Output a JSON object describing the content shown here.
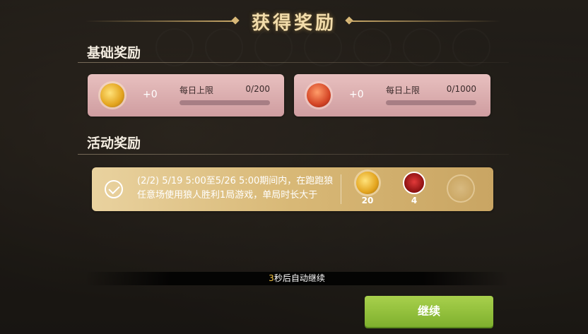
{
  "dialog": {
    "title": "获得奖励",
    "basic_section_title": "基础奖励",
    "activity_section_title": "活动奖励"
  },
  "basic_rewards": [
    {
      "icon": "gold-coin-icon",
      "gain": "+0",
      "limit_label": "每日上限",
      "limit_value": "0/200",
      "progress": 0
    },
    {
      "icon": "xp-gem-icon",
      "gain": "+0",
      "limit_label": "每日上限",
      "limit_value": "0/1000",
      "progress": 0
    }
  ],
  "activity_reward": {
    "description_line1": "(2/2) 5/19 5:00至5/26 5:00期间内，在跑跑狼",
    "description_line2": "任意场使用狼人胜利1局游戏，单局时长大于",
    "rewards": [
      {
        "icon": "gold-coin-icon",
        "count": "20"
      },
      {
        "icon": "rose-icon",
        "count": "4"
      },
      {
        "icon": "gift-icon",
        "count": ""
      }
    ]
  },
  "countdown": {
    "number": "3",
    "text": "秒后自动继续"
  },
  "continue_button": "继续"
}
